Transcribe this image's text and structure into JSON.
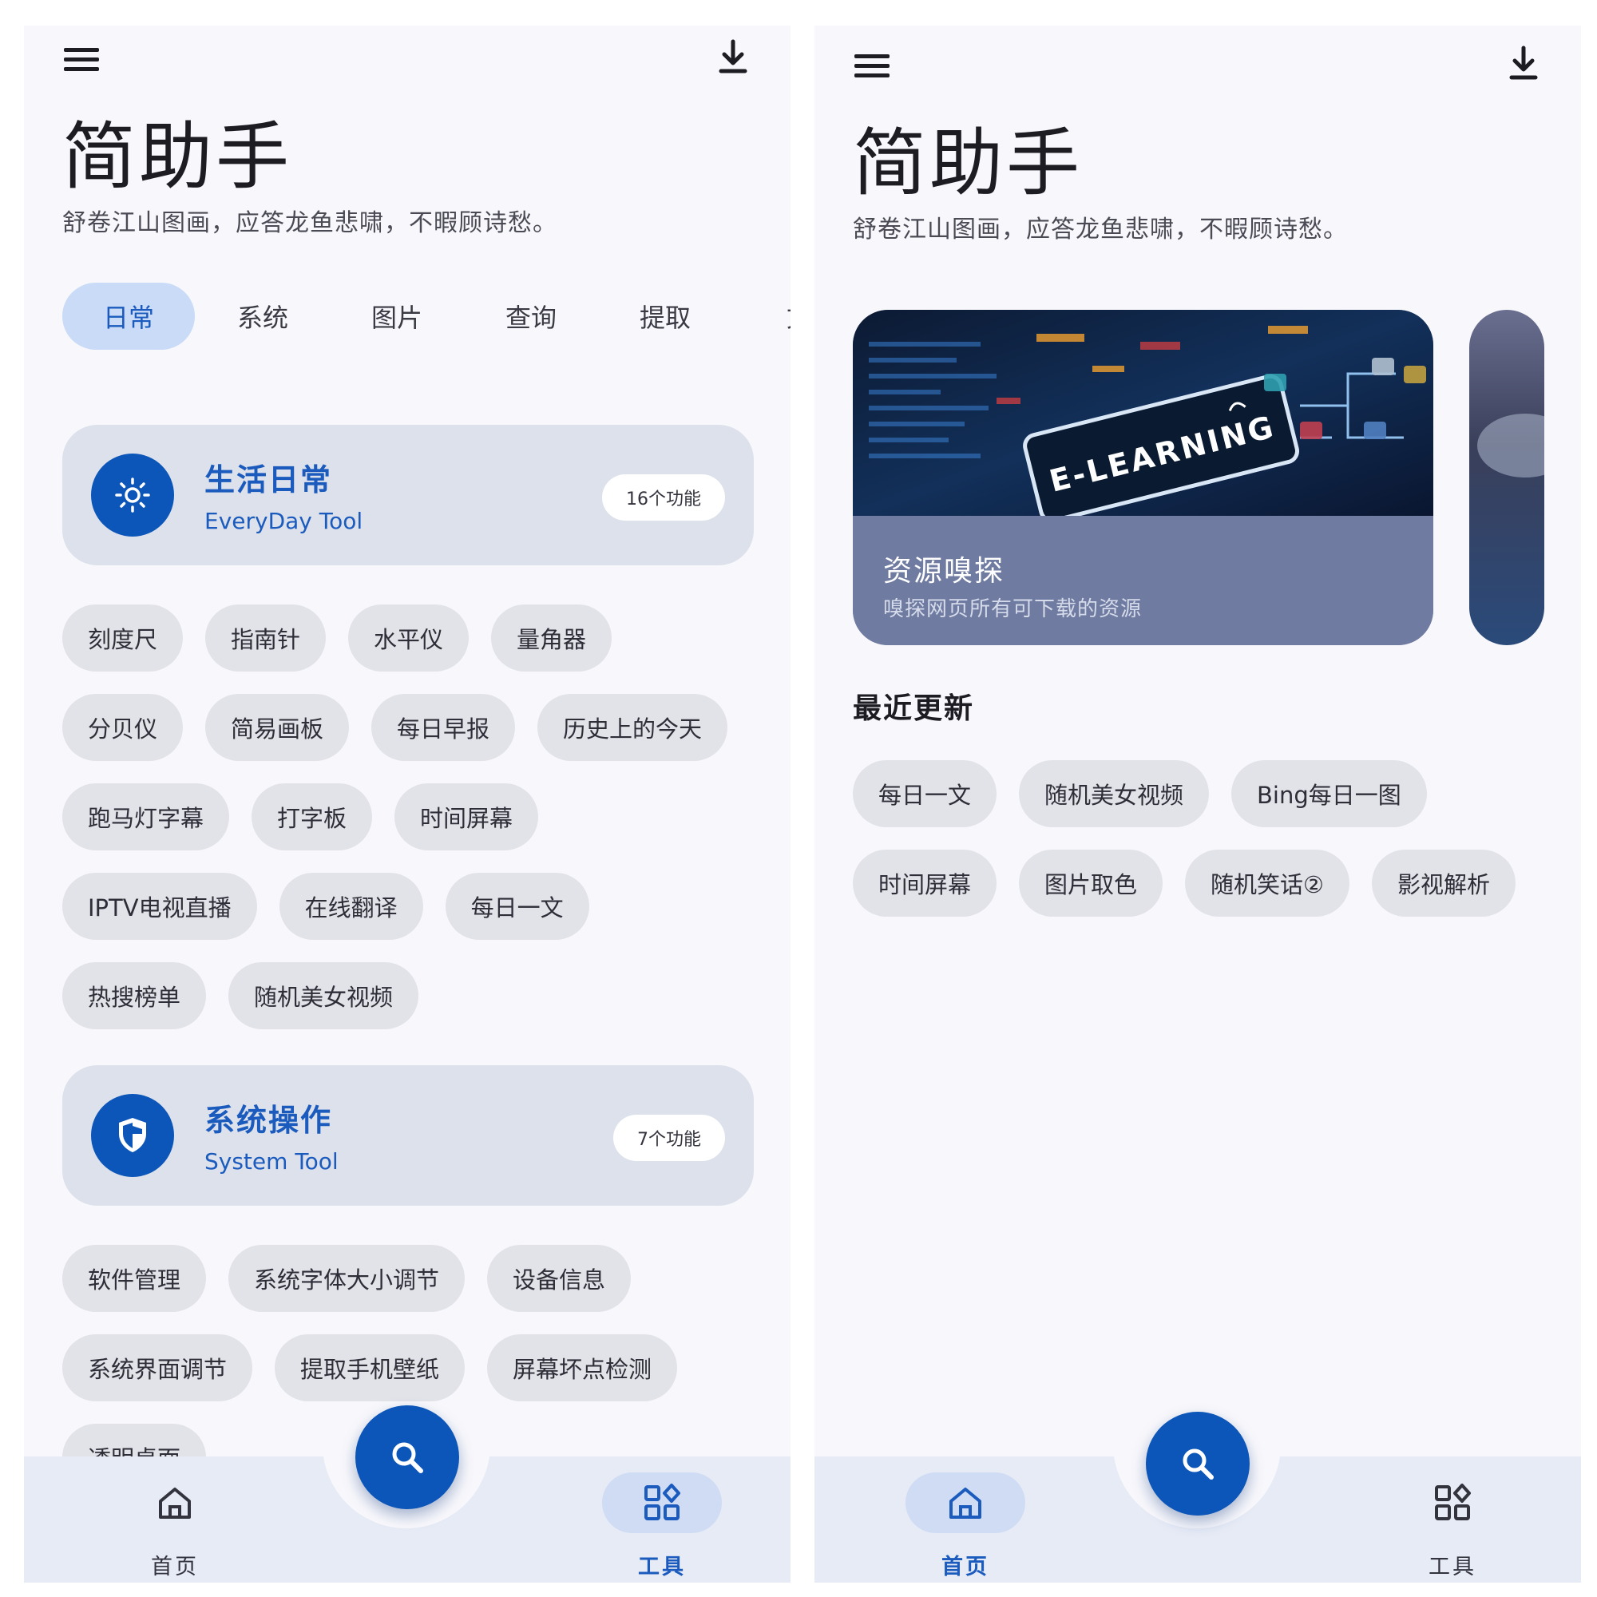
{
  "app": {
    "title": "简助手",
    "subtitle": "舒卷江山图画，应答龙鱼悲啸，不暇顾诗愁。"
  },
  "icons": {
    "menu": "menu-icon",
    "download": "download-icon",
    "search": "search-icon",
    "home": "home-icon",
    "tools": "grid-icon"
  },
  "colors": {
    "accent": "#0b56b8",
    "accent_text": "#1a5bbd",
    "tab_active_bg": "#c9dbf7",
    "chip_bg": "#e2e3e9",
    "section_bg": "#dde1eb",
    "nav_bg": "#e6ebf6"
  },
  "left_screen": {
    "tabs": [
      {
        "label": "日常",
        "active": true
      },
      {
        "label": "系统",
        "active": false
      },
      {
        "label": "图片",
        "active": false
      },
      {
        "label": "查询",
        "active": false
      },
      {
        "label": "提取",
        "active": false
      },
      {
        "label": "文",
        "active": false
      }
    ],
    "sections": [
      {
        "title": "生活日常",
        "subtitle": "EveryDay Tool",
        "count": "16个功能",
        "icon": "sun-icon",
        "chip_rows": [
          [
            "刻度尺",
            "指南针",
            "水平仪",
            "量角器"
          ],
          [
            "分贝仪",
            "简易画板",
            "每日早报",
            "历史上的今天"
          ],
          [
            "跑马灯字幕",
            "打字板",
            "时间屏幕"
          ],
          [
            "IPTV电视直播",
            "在线翻译",
            "每日一文"
          ],
          [
            "热搜榜单",
            "随机美女视频"
          ]
        ]
      },
      {
        "title": "系统操作",
        "subtitle": "System Tool",
        "count": "7个功能",
        "icon": "shield-icon",
        "chip_rows": [
          [
            "软件管理",
            "系统字体大小调节",
            "设备信息"
          ],
          [
            "系统界面调节",
            "提取手机壁纸",
            "屏幕坏点检测"
          ],
          [
            "透明桌面"
          ]
        ]
      }
    ],
    "nav": {
      "home_label": "首页",
      "tools_label": "工具",
      "active": "tools"
    }
  },
  "right_screen": {
    "banner": {
      "image_text": "E-LEARNING",
      "title": "资源嗅探",
      "subtitle": "嗅探网页所有可下载的资源"
    },
    "recent_title": "最近更新",
    "recent_rows": [
      [
        "每日一文",
        "随机美女视频",
        "Bing每日一图"
      ],
      [
        "时间屏幕",
        "图片取色",
        "随机笑话②",
        "影视解析"
      ]
    ],
    "nav": {
      "home_label": "首页",
      "tools_label": "工具",
      "active": "home"
    }
  }
}
